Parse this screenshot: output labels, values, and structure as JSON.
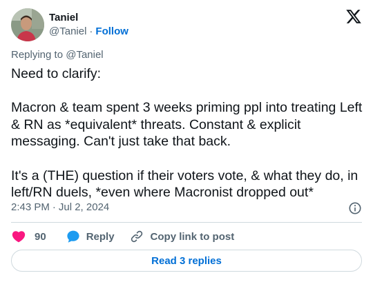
{
  "author": {
    "display_name": "Taniel",
    "handle": "@Taniel",
    "separator": "·",
    "follow_label": "Follow"
  },
  "reply_context": "Replying to @Taniel",
  "tweet": {
    "paragraphs": [
      "Need to clarify:",
      "Macron & team spent 3 weeks priming ppl into treating Left & RN as *equivalent* threats. Constant & explicit messaging. Can't just take that back.",
      "It's a (THE) question if their voters vote, & what they do, in left/RN duels, *even where Macronist dropped out*"
    ]
  },
  "meta": {
    "time": "2:43 PM",
    "separator": "·",
    "date": "Jul 2, 2024"
  },
  "actions": {
    "like_count": "90",
    "reply_label": "Reply",
    "copy_label": "Copy link to post"
  },
  "read_replies_label": "Read 3 replies",
  "colors": {
    "text": "#0f1419",
    "secondary": "#536471",
    "link": "#006fd6",
    "like": "#f91880",
    "reply": "#1d9bf0",
    "border": "#cfd9de"
  },
  "icons": [
    "x-logo-icon",
    "info-icon",
    "heart-icon",
    "reply-bubble-icon",
    "link-icon",
    "avatar"
  ]
}
